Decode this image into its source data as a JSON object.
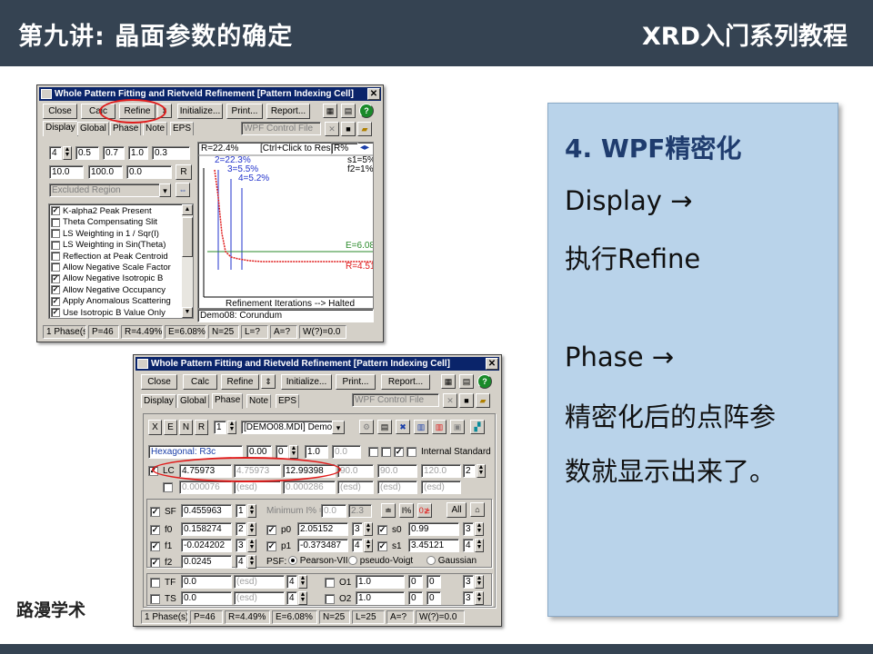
{
  "header": {
    "title": "第九讲: 晶面参数的确定",
    "series": "XRD入门系列教程"
  },
  "logo": "路漫学术",
  "panel": {
    "heading": "4. WPF精密化",
    "lines": [
      "Display →",
      "执行Refine",
      "Phase →",
      "精密化后的点阵参",
      "数就显示出来了。"
    ]
  },
  "win1": {
    "title": "Whole Pattern Fitting and Rietveld Refinement [Pattern Indexing Cell]",
    "buttons": [
      "Close",
      "Calc",
      "Refine",
      "Initialize...",
      "Print...",
      "Report..."
    ],
    "tabs": [
      "Display",
      "Global",
      "Phase",
      "Note",
      "EPS"
    ],
    "control_file": "WPF Control File",
    "row1": [
      "4",
      "0.5",
      "0.7",
      "1.0",
      "0.3"
    ],
    "row2": [
      "10.0",
      "100.0",
      "0.0"
    ],
    "row2_btn": "R",
    "excluded": "Excluded Region",
    "options": [
      {
        "label": "K-alpha2 Peak Present",
        "checked": true
      },
      {
        "label": "Theta Compensating Slit",
        "checked": false
      },
      {
        "label": "LS Weighting in 1 / Sqr(I)",
        "checked": false
      },
      {
        "label": "LS Weighting in Sin(Theta)",
        "checked": false
      },
      {
        "label": "Reflection at Peak Centroid",
        "checked": false
      },
      {
        "label": "Allow Negative Scale Factor",
        "checked": false
      },
      {
        "label": "Allow Negative Isotropic B",
        "checked": true
      },
      {
        "label": "Allow Negative Occupancy",
        "checked": true
      },
      {
        "label": "Apply Anomalous Scattering",
        "checked": true
      },
      {
        "label": "Use Isotropic B Value Only",
        "checked": true
      }
    ],
    "chart": {
      "r_label": "R=22.4%",
      "ctrl_hint": "[Ctrl+Click to Reset",
      "r_select": "R%",
      "annotations": [
        "2=22.3%",
        "3=5.5%",
        "4=5.2%"
      ],
      "s1": "s1=5%",
      "f2": "f2=1%",
      "e_label": "E=6.08",
      "r_end": "R=4.51",
      "xlabel": "Refinement Iterations --> Halted"
    },
    "demo": "Demo08: Corundum",
    "status": [
      "1 Phase(s)",
      "P=46",
      "R=4.49%",
      "E=6.08%",
      "N=25",
      "L=?",
      "A=?",
      "W(?)=0.0"
    ]
  },
  "win2": {
    "title": "Whole Pattern Fitting and Rietveld Refinement [Pattern Indexing Cell]",
    "buttons": [
      "Close",
      "Calc",
      "Refine",
      "Initialize...",
      "Print...",
      "Report..."
    ],
    "tabs": [
      "Display",
      "Global",
      "Phase",
      "Note",
      "EPS"
    ],
    "control_file": "WPF Control File",
    "letters": [
      "X",
      "E",
      "N",
      "R",
      "1"
    ],
    "file": "[DEMO08.MDI] Demo",
    "spacegroup": "Hexagonal: R3c",
    "sg_vals": [
      "0.00",
      "0",
      "1.0",
      "0.0"
    ],
    "internal_standard": "Internal Standard",
    "lc": {
      "label": "LC",
      "a": "4.75973",
      "b": "4.75973",
      "c": "12.99398",
      "alpha": "90.0",
      "beta": "90.0",
      "gamma": "120.0",
      "n": "2"
    },
    "esd": [
      "0.000076",
      "(esd)",
      "0.000286",
      "(esd)",
      "(esd)",
      "(esd)"
    ],
    "sf": {
      "label": "SF",
      "value": "0.455963",
      "n": "1"
    },
    "minimum": "Minimum I% =",
    "min_vals": [
      "0.0",
      "2.3"
    ],
    "all_btn": "All",
    "f_rows": [
      {
        "label": "f0",
        "value": "0.158274",
        "n": "2"
      },
      {
        "label": "f1",
        "value": "-0.024202",
        "n": "3"
      },
      {
        "label": "f2",
        "value": "0.0245",
        "n": "4"
      }
    ],
    "p_rows": [
      {
        "label": "p0",
        "value": "2.05152",
        "n": "3"
      },
      {
        "label": "p1",
        "value": "-0.373487",
        "n": "4"
      }
    ],
    "s_rows": [
      {
        "label": "s0",
        "value": "0.99",
        "n": "3"
      },
      {
        "label": "s1",
        "value": "3.45121",
        "n": "4"
      }
    ],
    "psf": {
      "label": "PSF:",
      "options": [
        "Pearson-VII",
        "pseudo-Voigt",
        "Gaussian"
      ]
    },
    "tf": {
      "label": "TF",
      "value": "0.0",
      "esd": "(esd)",
      "n": "4"
    },
    "ts": {
      "label": "TS",
      "value": "0.0",
      "esd": "(esd)",
      "n": "4"
    },
    "o1": {
      "label": "O1",
      "value": "1.0",
      "a": "0",
      "b": "0",
      "n": "3"
    },
    "o2": {
      "label": "O2",
      "value": "1.0",
      "a": "0",
      "b": "0",
      "n": "3"
    },
    "status": [
      "1 Phase(s)",
      "P=46",
      "R=4.49%",
      "E=6.08%",
      "N=25",
      "L=25",
      "A=?",
      "W(?)=0.0"
    ]
  }
}
